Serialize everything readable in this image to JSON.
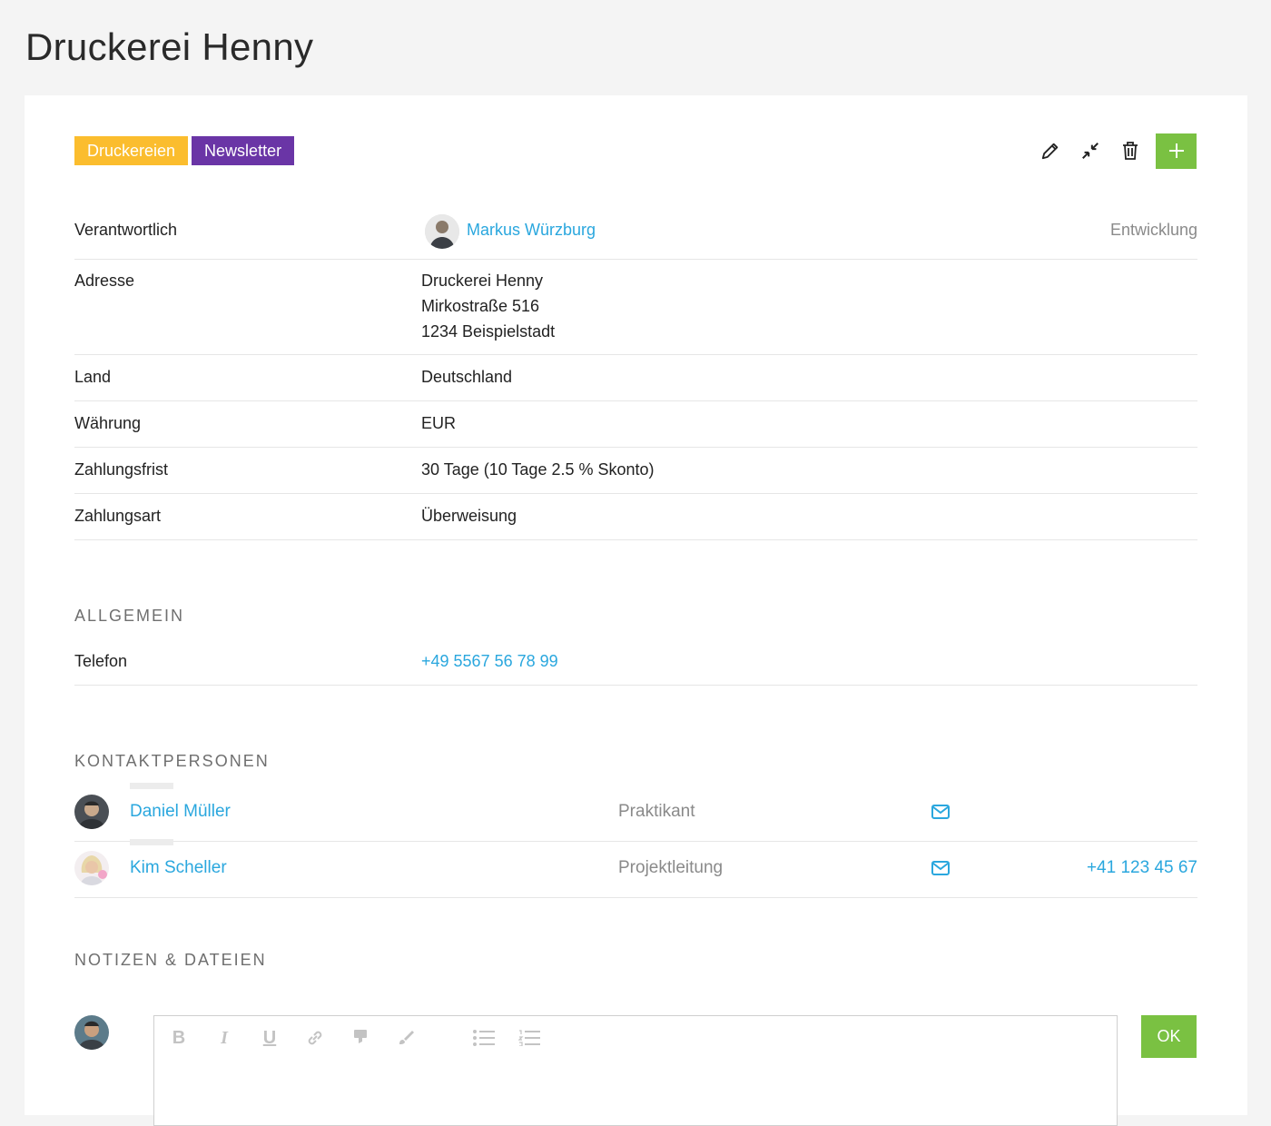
{
  "page": {
    "title": "Druckerei Henny"
  },
  "tags": [
    {
      "label": "Druckereien",
      "color": "#fbbd2e"
    },
    {
      "label": "Newsletter",
      "color": "#6a35a6"
    }
  ],
  "toolbar": {
    "icons": [
      "pencil-icon",
      "collapse-icon",
      "trash-icon",
      "plus-icon"
    ],
    "accent": "#7ac142"
  },
  "details": {
    "responsible": {
      "label": "Verantwortlich",
      "name": "Markus Würzburg",
      "department": "Entwicklung"
    },
    "address": {
      "label": "Adresse",
      "line1": "Druckerei Henny",
      "line2": "Mirkostraße 516",
      "line3": "1234 Beispielstadt"
    },
    "country": {
      "label": "Land",
      "value": "Deutschland"
    },
    "currency": {
      "label": "Währung",
      "value": "EUR"
    },
    "payment_term": {
      "label": "Zahlungsfrist",
      "value": "30 Tage (10 Tage 2.5 % Skonto)"
    },
    "payment_method": {
      "label": "Zahlungsart",
      "value": "Überweisung"
    }
  },
  "general": {
    "heading": "ALLGEMEIN",
    "phone": {
      "label": "Telefon",
      "value": "+49 5567 56 78 99"
    }
  },
  "contacts": {
    "heading": "KONTAKTPERSONEN",
    "items": [
      {
        "name": "Daniel Müller",
        "role": "Praktikant",
        "phone": ""
      },
      {
        "name": "Kim Scheller",
        "role": "Projektleitung",
        "phone": "+41 123 45 67"
      }
    ]
  },
  "notes": {
    "heading": "NOTIZEN & DATEIEN",
    "ok_label": "OK",
    "editor_tools": [
      "bold-icon",
      "italic-icon",
      "underline-icon",
      "link-icon",
      "highlight-icon",
      "brush-icon",
      "bullet-list-icon",
      "numbered-list-icon"
    ]
  },
  "colors": {
    "link": "#2aa7de",
    "green": "#7ac142"
  }
}
